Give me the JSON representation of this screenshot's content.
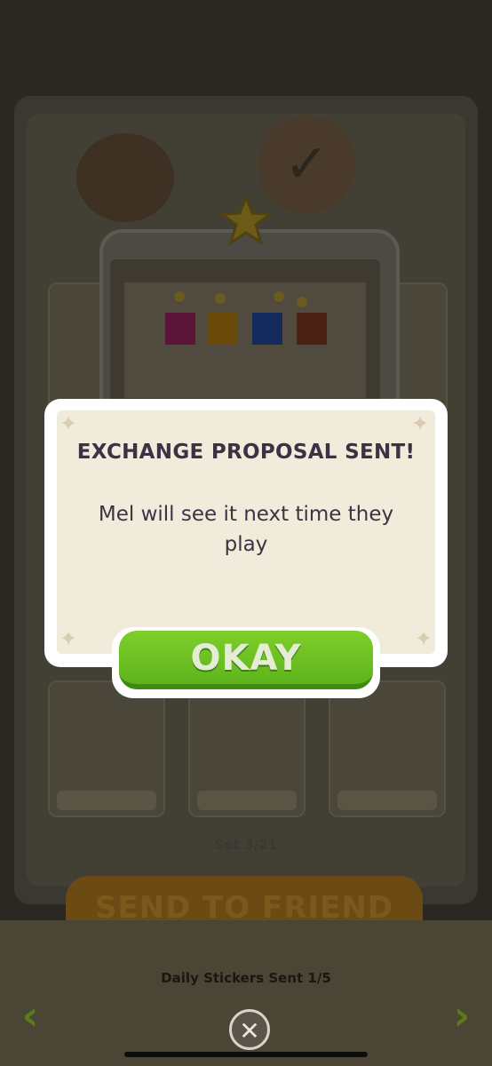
{
  "background": {
    "set_counter": "Set 3/21",
    "send_button_label": "SEND TO FRIEND",
    "daily_stickers_sent": "Daily Stickers Sent 1/5",
    "prev_arrow": "‹",
    "next_arrow": "›",
    "close_glyph": "✕"
  },
  "dialog": {
    "title": "EXCHANGE PROPOSAL SENT!",
    "message": "Mel will see it next time they play",
    "okay_label": "OKAY"
  },
  "colors": {
    "okay_green": "#6cc224",
    "dialog_panel": "#f1ebdc",
    "title_text": "#3b3343"
  },
  "icons": {
    "close": "close-icon",
    "prev": "chevron-left-icon",
    "next": "chevron-right-icon",
    "star": "star-icon"
  }
}
